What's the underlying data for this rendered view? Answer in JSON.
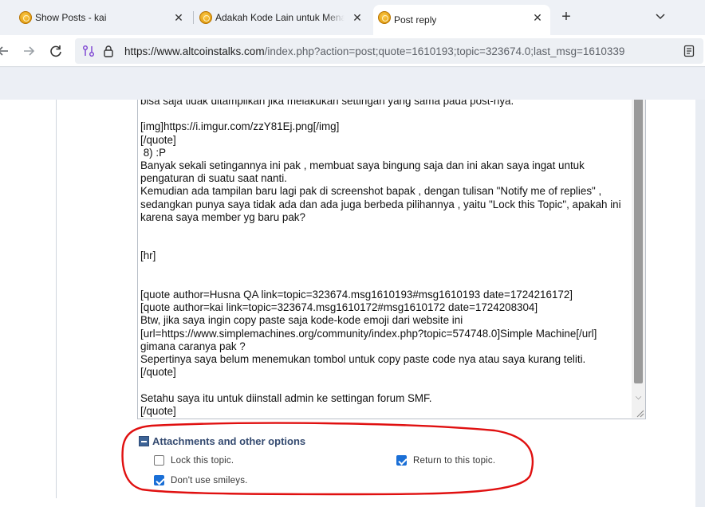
{
  "tabs": [
    {
      "title": "Show Posts - kai",
      "close": "✕"
    },
    {
      "title": "Adakah Kode Lain untuk Menam",
      "close": "✕"
    },
    {
      "title": "Post reply",
      "close": "✕"
    }
  ],
  "new_tab": "+",
  "tab_menu": "⌄",
  "address": {
    "url_host": "https://www.altcoinstalks.com",
    "url_rest": "/index.php?action=post;quote=1610193;topic=323674.0;last_msg=1610339"
  },
  "editor": {
    "text": "bisa saja tidak ditampilkan jika melakukan settingan yang sama pada post-nya.\n\n[img]https://i.imgur.com/zzY81Ej.png[/img]\n[/quote]\n 8) :P\nBanyak sekali setingannya ini pak , membuat saya bingung saja dan ini akan saya ingat untuk pengaturan di suatu saat nanti.\nKemudian ada tampilan baru lagi pak di screenshot bapak , dengan tulisan \"Notify me of replies\" , sedangkan punya saya tidak ada dan ada juga berbeda pilihannya , yaitu \"Lock this Topic\", apakah ini karena saya member yg baru pak?\n\n\n[hr]\n\n\n[quote author=Husna QA link=topic=323674.msg1610193#msg1610193 date=1724216172]\n[quote author=kai link=topic=323674.msg1610172#msg1610172 date=1724208304]\nBtw, jika saya ingin copy paste saja kode-kode emoji dari website ini [url=https://www.simplemachines.org/community/index.php?topic=574748.0]Simple Machine[/url]  gimana caranya pak ?\nSepertinya saya belum menemukan tombol untuk copy paste code nya atau saya kurang teliti.\n[/quote]\n\nSetahu saya itu untuk diinstall admin ke settingan forum SMF.\n[/quote]"
  },
  "options": {
    "header": "Attachments and other options",
    "lock_topic": {
      "label": "Lock this topic.",
      "checked": false
    },
    "return_topic": {
      "label": "Return to this topic.",
      "checked": true
    },
    "no_smileys": {
      "label": "Don't use smileys.",
      "checked": true
    }
  },
  "colors": {
    "checkbox_checked": "#1a6fd6",
    "annotation_circle": "#e01010",
    "options_header": "#344a70"
  }
}
